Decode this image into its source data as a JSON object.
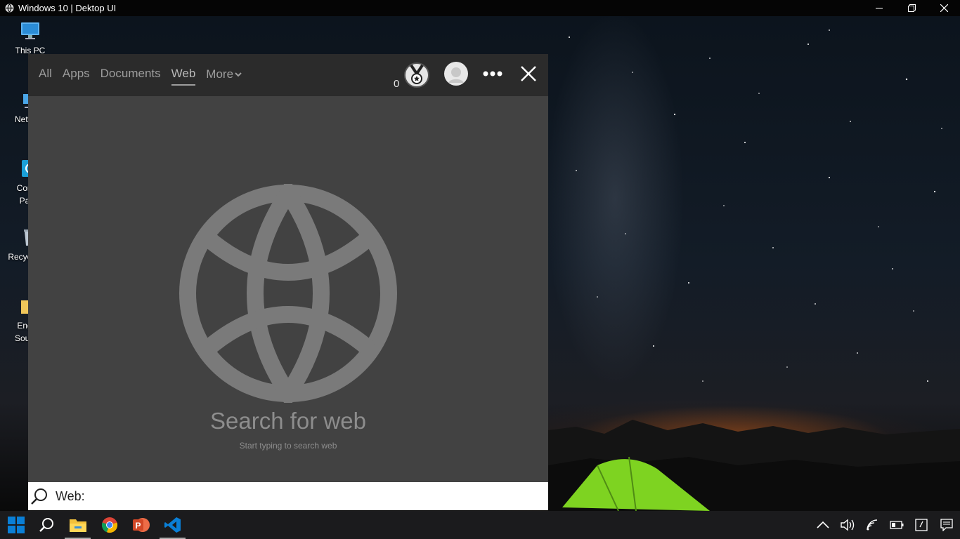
{
  "window": {
    "title": "Windows 10 | Dektop UI"
  },
  "desktop": {
    "icons": [
      {
        "label_lines": [
          "This PC"
        ]
      },
      {
        "label_lines": [
          "Network"
        ]
      },
      {
        "label_lines": [
          "Control",
          "Panel"
        ]
      },
      {
        "label_lines": [
          "Recycle Bin"
        ]
      },
      {
        "label_lines": [
          "Engine",
          "Sources"
        ]
      }
    ]
  },
  "search": {
    "tabs": [
      {
        "label": "All"
      },
      {
        "label": "Apps"
      },
      {
        "label": "Documents"
      },
      {
        "label": "Web",
        "active": true
      },
      {
        "label": "More"
      }
    ],
    "reward_count": "0",
    "empty_title": "Search for web",
    "empty_subtitle": "Start typing to search web",
    "scope_label": "Web:",
    "query": ""
  },
  "taskbar": {
    "pinned": [
      {
        "icon": "search-icon"
      },
      {
        "icon": "file-explorer-icon",
        "running": true
      },
      {
        "icon": "chrome-icon"
      },
      {
        "icon": "powerpoint-icon"
      },
      {
        "icon": "vscode-icon",
        "running": true
      }
    ],
    "tray": [
      "chevron-up-icon",
      "volume-icon",
      "wifi-icon",
      "battery-icon",
      "notes-icon",
      "notifications-icon"
    ]
  },
  "colors": {
    "panel_header": "#2b2b2b",
    "panel_body": "#424242",
    "muted_text": "#8d8d8d",
    "taskbar": "#1b1b1d",
    "tent_green": "#7ed321",
    "vscode_blue": "#0a7fd6",
    "powerpoint_red": "#d24726"
  }
}
